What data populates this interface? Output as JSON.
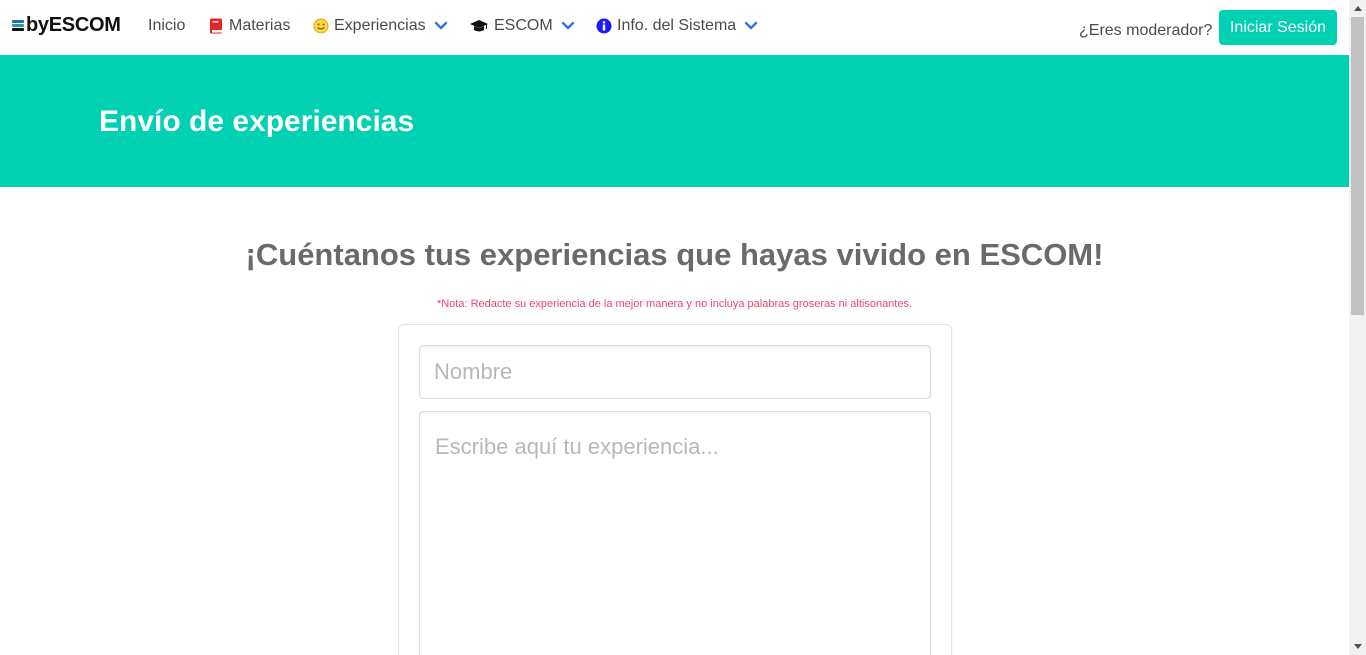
{
  "nav": {
    "brand": "byESCOM",
    "items": [
      {
        "label": "Inicio"
      },
      {
        "label": "Materias",
        "icon": "book-icon"
      },
      {
        "label": "Experiencias",
        "icon": "smile-icon"
      },
      {
        "label": "ESCOM",
        "icon": "graduation-cap-icon"
      },
      {
        "label": "Info. del Sistema",
        "icon": "info-icon"
      }
    ],
    "moderator_text": "¿Eres moderador?",
    "login_label": "Iniciar Sesión"
  },
  "hero": {
    "title": "Envío de experiencias"
  },
  "main": {
    "heading": "¡Cuéntanos tus experiencias que hayas vivido en ESCOM!",
    "note": "*Nota: Redacte su experiencia de la mejor manera y no incluya palabras groseras ni altisonantes.",
    "name_placeholder": "Nombre",
    "experience_placeholder": "Escribe aquí tu experiencia..."
  },
  "colors": {
    "accent": "#00d1b2",
    "note": "#f14668",
    "link_chevron": "#3273dc"
  }
}
